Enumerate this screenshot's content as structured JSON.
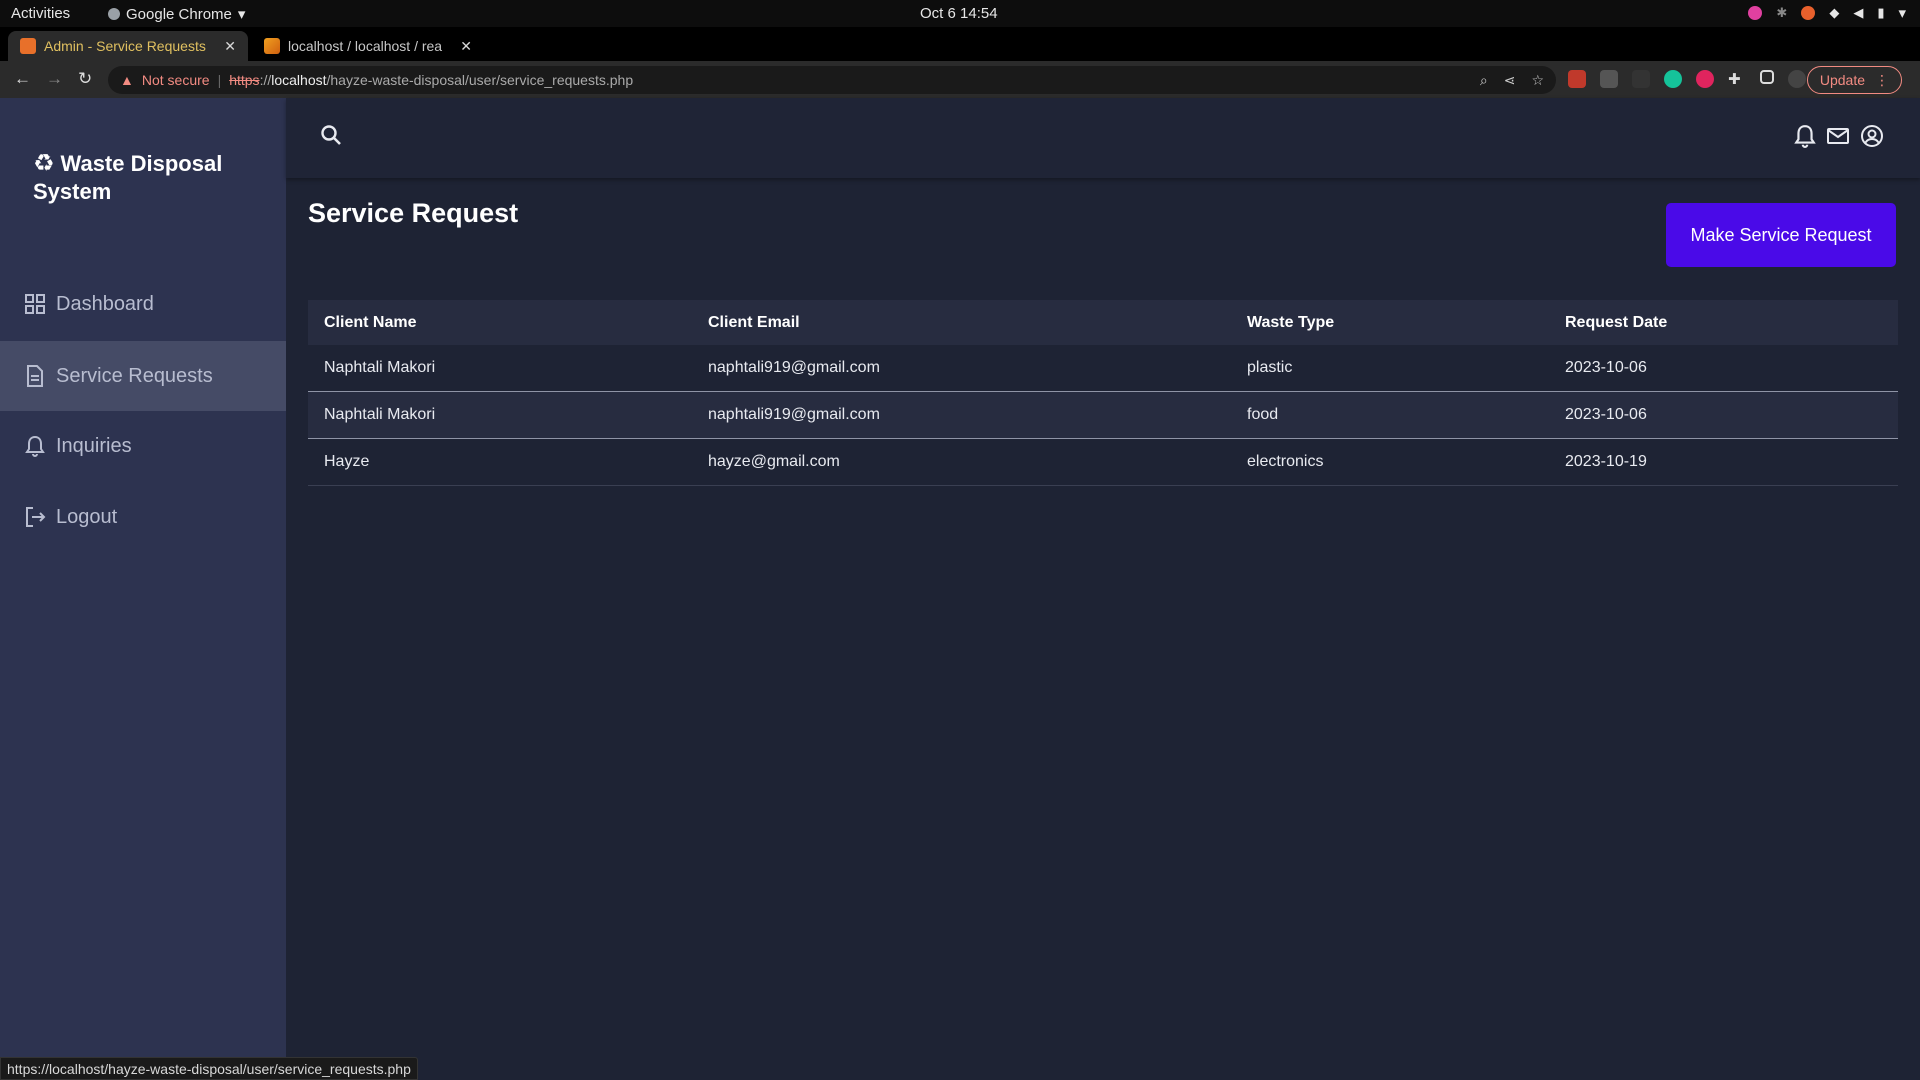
{
  "system": {
    "activities": "Activities",
    "app_name": "Google Chrome",
    "clock": "Oct 6  14:54"
  },
  "browser": {
    "tabs": [
      {
        "title": "Admin - Service Requests",
        "active": true
      },
      {
        "title": "localhost / localhost / rea",
        "active": false
      }
    ],
    "not_secure": "Not secure",
    "url_scheme": "https",
    "url_sep": "://",
    "url_host": "localhost",
    "url_path": "/hayze-waste-disposal/user/service_requests.php",
    "update_label": "Update",
    "status_url": "https://localhost/hayze-waste-disposal/user/service_requests.php"
  },
  "sidebar": {
    "brand": "Waste Disposal System",
    "items": [
      {
        "label": "Dashboard",
        "icon": "dashboard-icon"
      },
      {
        "label": "Service Requests",
        "icon": "document-icon",
        "active": true
      },
      {
        "label": "Inquiries",
        "icon": "bell-icon"
      },
      {
        "label": "Logout",
        "icon": "logout-icon"
      }
    ]
  },
  "header": {
    "icons": [
      "search-icon",
      "bell-icon",
      "mail-icon",
      "user-circle-icon"
    ]
  },
  "main": {
    "title": "Service Request",
    "make_request_label": "Make Service Request",
    "table": {
      "columns": [
        "Client Name",
        "Client Email",
        "Waste Type",
        "Request Date"
      ],
      "rows": [
        [
          "Naphtali Makori",
          "naphtali919@gmail.com",
          "plastic",
          "2023-10-06"
        ],
        [
          "Naphtali Makori",
          "naphtali919@gmail.com",
          "food",
          "2023-10-06"
        ],
        [
          "Hayze",
          "hayze@gmail.com",
          "electronics",
          "2023-10-19"
        ]
      ]
    }
  },
  "colors": {
    "sidebar_bg": "#2d3350",
    "main_bg": "#1e2334",
    "accent_button": "#4a0ae8"
  }
}
